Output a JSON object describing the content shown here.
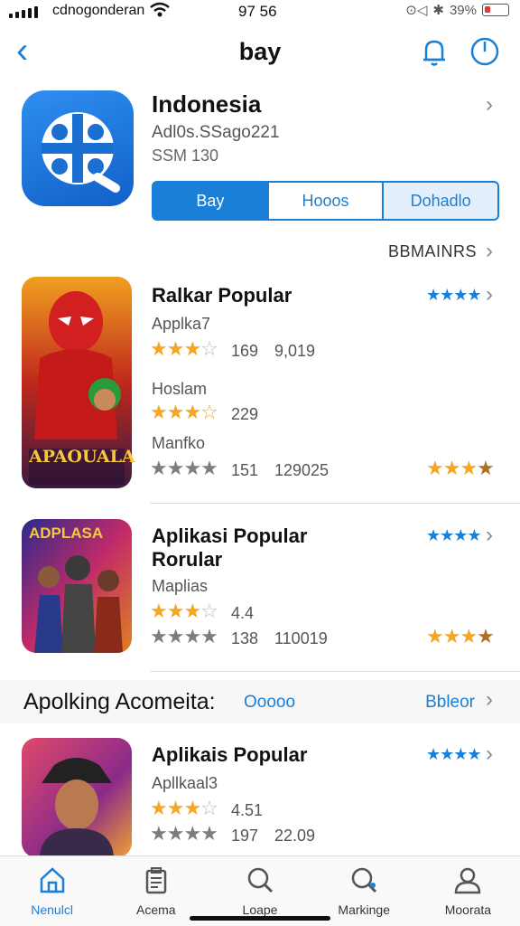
{
  "status_bar": {
    "carrier": "cdnogonderan",
    "time": "97 56",
    "battery": "39%"
  },
  "nav": {
    "title": "bay"
  },
  "featured": {
    "title": "Indonesia",
    "subtitle": "Adl0s.SSago221",
    "meta": "SSM   130",
    "buttons": [
      "Bay",
      "Hooos",
      "Dohadlo"
    ]
  },
  "see_all": "BBMAINRS",
  "apps": [
    {
      "name": "Ralkar Popular",
      "thumb_text": "APAOUALA",
      "rows": [
        {
          "label": "Applka7",
          "stars": 3.5,
          "style": "gold",
          "count": "169",
          "extra": "9,019"
        },
        {
          "label": "Hoslam",
          "stars": 3.5,
          "style": "gold",
          "count": "229",
          "extra": ""
        },
        {
          "label": "Manfko",
          "stars": 4,
          "style": "grey",
          "count": "151",
          "extra": "129025"
        }
      ]
    },
    {
      "name": "Aplikasi Popular",
      "name2": "Rorular",
      "thumb_text": "ADPLASA",
      "rows": [
        {
          "label": "Maplias",
          "stars": 3.5,
          "style": "gold",
          "count": "4.4",
          "extra": ""
        },
        {
          "label": "",
          "stars": 4,
          "style": "grey",
          "count": "138",
          "extra": "110019"
        }
      ]
    },
    {
      "name": "Aplikais Popular",
      "rows": [
        {
          "label": "Apllkaal3",
          "stars": 3.5,
          "style": "gold",
          "count": "4.51",
          "extra": ""
        },
        {
          "label": "",
          "stars": 4,
          "style": "grey",
          "count": "197",
          "extra": "22.09"
        }
      ]
    }
  ],
  "section": {
    "title": "Apolking Acomeita:",
    "link_left": "Ooooo",
    "link_right": "Bbleor"
  },
  "tabs": [
    {
      "label": "Nenulcl",
      "icon": "home-icon",
      "active": true
    },
    {
      "label": "Acema",
      "icon": "clipboard-icon",
      "active": false
    },
    {
      "label": "Loape",
      "icon": "search-icon",
      "active": false
    },
    {
      "label": "Markinge",
      "icon": "search-plus-icon",
      "active": false
    },
    {
      "label": "Moorata",
      "icon": "person-icon",
      "active": false
    }
  ],
  "colors": {
    "accent": "#1a7fd6",
    "star_gold": "#f5a623",
    "star_grey": "#7d7d7d"
  }
}
